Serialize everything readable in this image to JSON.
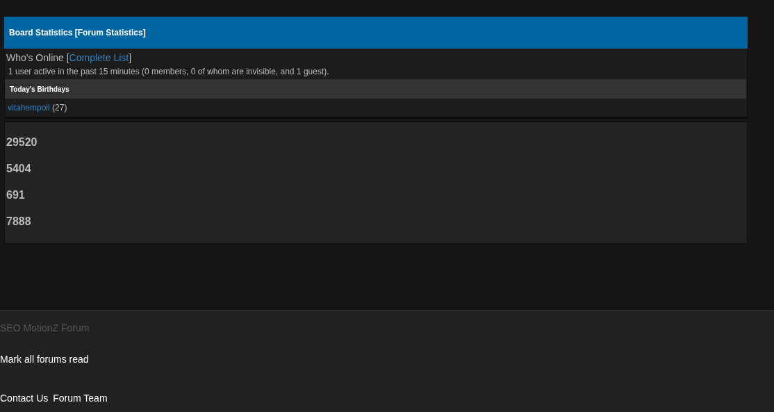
{
  "board_statistics": {
    "title": "Board Statistics [Forum Statistics]",
    "whos_online": {
      "label": "Who's Online",
      "bracket_open": "[",
      "link": "Complete List",
      "bracket_close": "]",
      "summary": "1 user active in the past 15 minutes (0 members, 0 of whom are invisible, and 1 guest)."
    },
    "birthdays": {
      "heading": "Today's Birthdays",
      "user": "vitahempoil",
      "age": "(27)"
    },
    "stats": [
      "29520",
      "5404",
      "691",
      "7888"
    ]
  },
  "footer": {
    "site_name": "SEO MotionZ Forum",
    "mark_read": "Mark all forums read",
    "links": [
      "Contact Us",
      "Forum Team"
    ]
  }
}
